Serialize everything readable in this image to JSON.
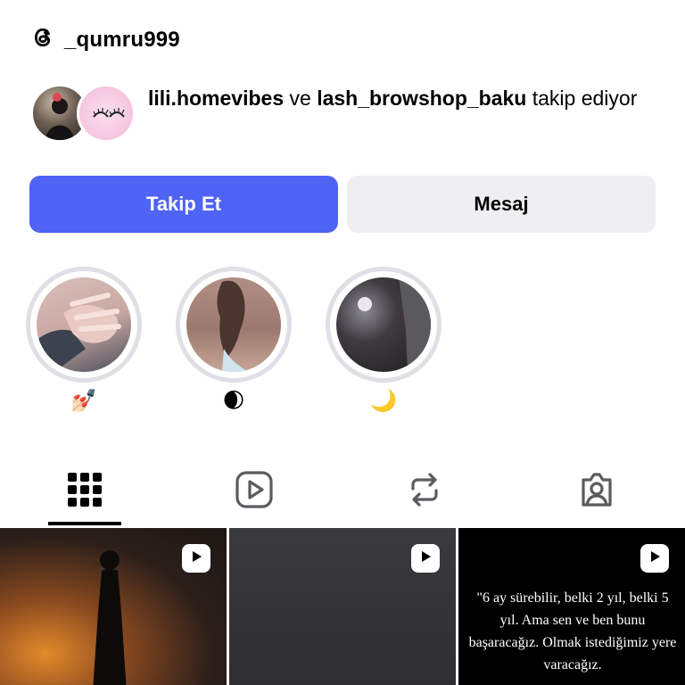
{
  "profile": {
    "threads_handle": "_qumru999",
    "followed_by_user1": "lili.homevibes",
    "connector": "ve",
    "followed_by_user2": "lash_browshop_baku",
    "followed_by_suffix": "takip ediyor"
  },
  "actions": {
    "follow_label": "Takip Et",
    "message_label": "Mesaj"
  },
  "highlights": [
    {
      "emoji": "💅🏻"
    },
    {
      "emoji": "🌒"
    },
    {
      "emoji": "🌙"
    }
  ],
  "tabs": [
    {
      "icon": "grid-icon",
      "active": true
    },
    {
      "icon": "reels-icon",
      "active": false
    },
    {
      "icon": "reposts-icon",
      "active": false
    },
    {
      "icon": "tagged-icon",
      "active": false
    }
  ],
  "posts": [
    {
      "type": "reel",
      "caption": ""
    },
    {
      "type": "reel",
      "caption": ""
    },
    {
      "type": "reel",
      "caption": "\"6 ay sürebilir, belki 2 yıl, belki 5 yıl. Ama sen ve ben bunu başaracağız. Olmak istediğimiz yere varacağız."
    }
  ],
  "colors": {
    "follow_button": "#4f63f5",
    "message_button": "#efeff2",
    "highlight_ring": "#dfe0e5"
  }
}
